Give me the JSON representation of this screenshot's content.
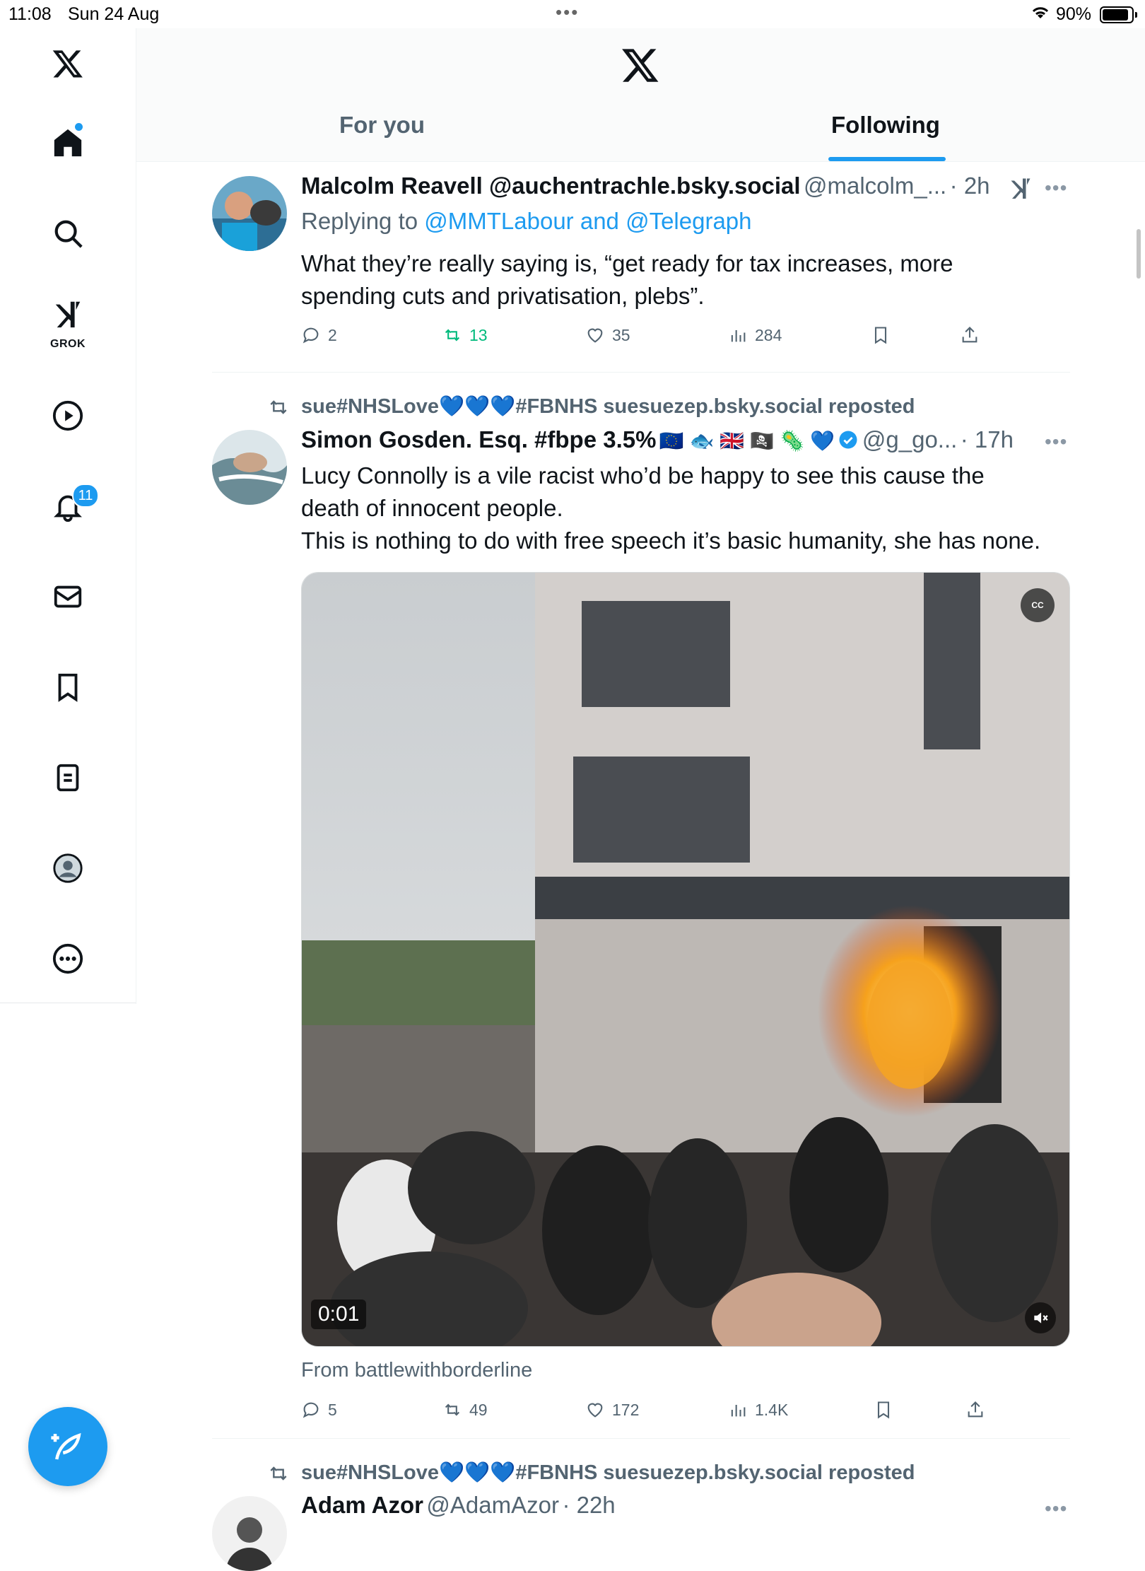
{
  "status_bar": {
    "time": "11:08",
    "date": "Sun 24 Aug",
    "battery_pct": "90%",
    "battery_level": 0.9
  },
  "sidebar": {
    "notifications_badge": "11",
    "grok_label": "GROK",
    "items": [
      {
        "icon": "x-logo-icon"
      },
      {
        "icon": "home-icon"
      },
      {
        "icon": "search-icon"
      },
      {
        "icon": "grok-icon"
      },
      {
        "icon": "play-icon"
      },
      {
        "icon": "bell-icon"
      },
      {
        "icon": "mail-icon"
      },
      {
        "icon": "bookmark-icon"
      },
      {
        "icon": "list-icon"
      },
      {
        "icon": "profile-icon"
      },
      {
        "icon": "more-icon"
      }
    ]
  },
  "header": {
    "tabs": [
      {
        "label": "For you"
      },
      {
        "label": "Following"
      }
    ],
    "active_tab": "Following"
  },
  "colors": {
    "accent": "#1d9bf0",
    "retweet_green": "#00ba7c",
    "muted": "#536471"
  },
  "tweets": [
    {
      "name": "Malcolm Reavell @auchentrachle.bsky.social",
      "handle": "@malcolm_...",
      "time": "· 2h",
      "replying_prefix": "Replying to",
      "replying_to": "@MMTLabour and @Telegraph",
      "text_line1": "What they’re really saying is, “get ready for tax increases, more",
      "text_line2": "spending cuts and privatisation, plebs”.",
      "stats": {
        "replies": "2",
        "reposts": "13",
        "likes": "35",
        "views": "284"
      }
    },
    {
      "reposted_by": "sue#NHSLove💙💙💙#FBNHS suesuezep.bsky.social reposted",
      "name": "Simon Gosden. Esq. #fbpe 3.5%",
      "name_emojis": "🇪🇺 🐟 🇬🇧 🏴‍☠️ 🦠 💙",
      "handle": "@g_go...",
      "time": "· 17h",
      "text_line1": "Lucy Connolly is a vile racist who’d be happy to see this cause the",
      "text_line2": "death of innocent people.",
      "text_line3": "This is nothing to do with free speech it’s basic humanity, she has none.",
      "video_duration": "0:01",
      "cc_label": "CC",
      "from": "From battlewithborderline",
      "stats": {
        "replies": "5",
        "reposts": "49",
        "likes": "172",
        "views": "1.4K"
      }
    },
    {
      "reposted_by": "sue#NHSLove💙💙💙#FBNHS suesuezep.bsky.social reposted",
      "name": "Adam Azor",
      "handle": "@AdamAzor",
      "time": "· 22h"
    }
  ]
}
